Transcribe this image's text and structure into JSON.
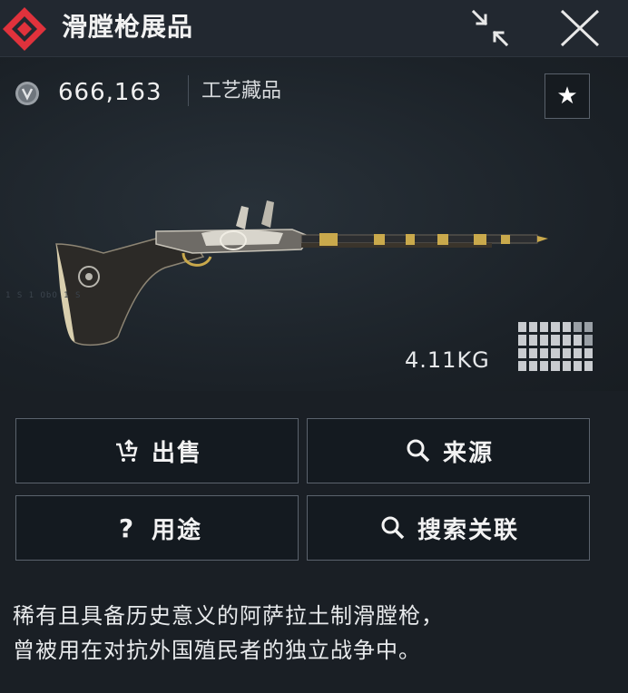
{
  "window": {
    "title": "滑膛枪展品"
  },
  "item": {
    "price": "666,163",
    "category": "工艺藏品",
    "weight": "4.11KG",
    "faint_caption": "1 S 1 ObO 1 S",
    "rarity_color": "#e0323c",
    "size_grid": {
      "columns": 7,
      "rows": 4
    }
  },
  "actions": {
    "sell": {
      "label": "出售",
      "icon": "sell-cart-icon"
    },
    "source": {
      "label": "来源",
      "icon": "search-icon"
    },
    "usage": {
      "label": "用途",
      "icon": "question-icon"
    },
    "search_related": {
      "label": "搜索关联",
      "icon": "search-icon"
    }
  },
  "description": {
    "line1": "稀有且具备历史意义的阿萨拉土制滑膛枪，",
    "line2": "曾被用在对抗外国殖民者的独立战争中。"
  }
}
